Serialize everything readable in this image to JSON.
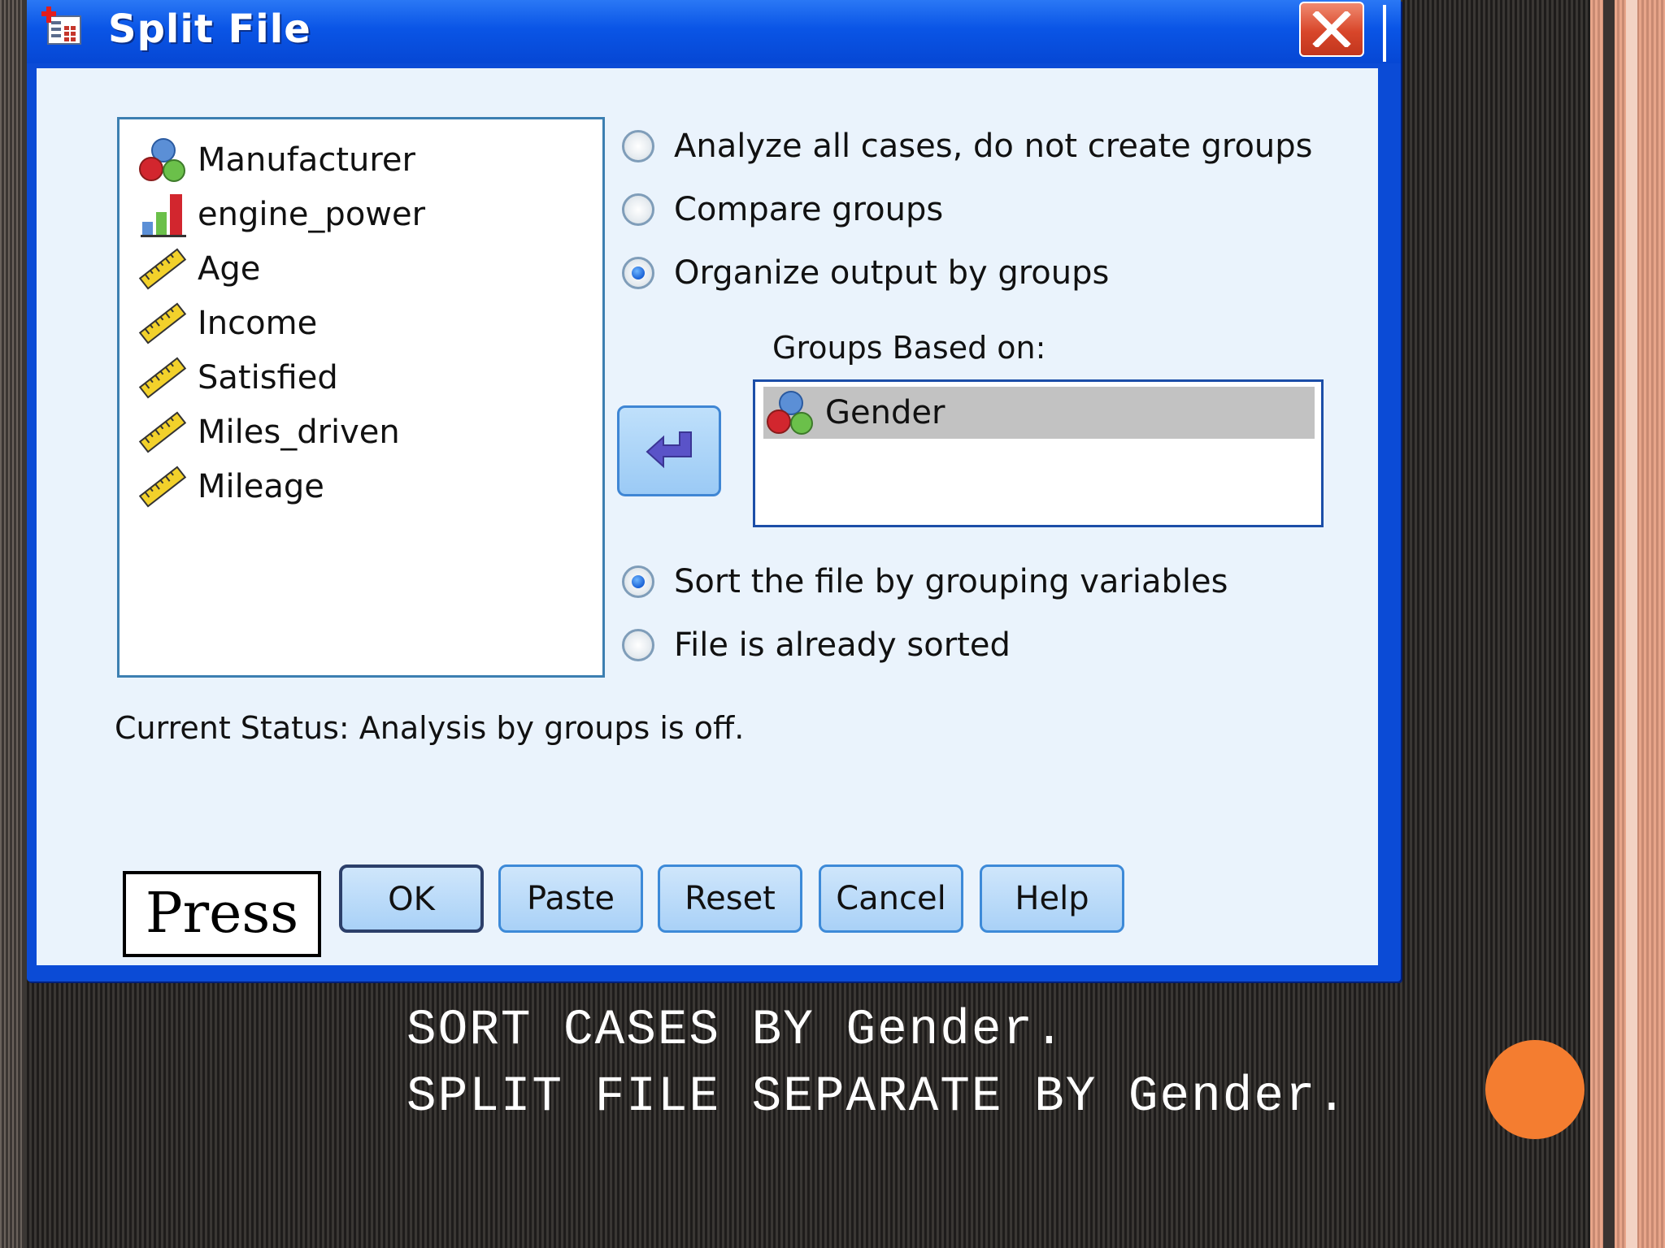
{
  "window": {
    "title": "Split File",
    "close_icon": "close-icon"
  },
  "variables": [
    {
      "label": "Manufacturer",
      "icon": "nominal-variable-icon"
    },
    {
      "label": "engine_power",
      "icon": "ordinal-variable-icon"
    },
    {
      "label": "Age",
      "icon": "scale-variable-icon"
    },
    {
      "label": "Income",
      "icon": "scale-variable-icon"
    },
    {
      "label": "Satisfied",
      "icon": "scale-variable-icon"
    },
    {
      "label": "Miles_driven",
      "icon": "scale-variable-icon"
    },
    {
      "label": "Mileage",
      "icon": "scale-variable-icon"
    }
  ],
  "analysis_options": [
    {
      "label": "Analyze all cases, do not create groups",
      "checked": false
    },
    {
      "label": "Compare groups",
      "checked": false
    },
    {
      "label": "Organize output by groups",
      "checked": true
    }
  ],
  "groups": {
    "label": "Groups Based on:",
    "items": [
      {
        "label": "Gender",
        "icon": "nominal-variable-icon",
        "selected": true
      }
    ]
  },
  "sort_options": [
    {
      "label": "Sort the file by grouping variables",
      "checked": true
    },
    {
      "label": "File is already sorted",
      "checked": false
    }
  ],
  "status": "Current Status: Analysis by groups is off.",
  "buttons": {
    "ok": "OK",
    "paste": "Paste",
    "reset": "Reset",
    "cancel": "Cancel",
    "help": "Help"
  },
  "callout": "Press",
  "syntax": {
    "line1": "SORT CASES BY Gender.",
    "line2": "SPLIT FILE SEPARATE BY Gender."
  },
  "colors": {
    "accent_circle": "#f47d30",
    "title_bar": "#0a55e6",
    "dialog_bg": "#eaf3fc"
  }
}
